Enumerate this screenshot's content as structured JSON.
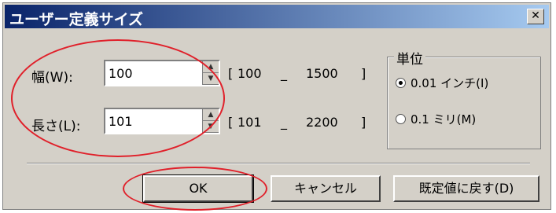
{
  "dialog": {
    "title": "ユーザー定義サイズ",
    "close_glyph": "✕"
  },
  "width_row": {
    "label": "幅(W):",
    "value": "100",
    "range_open": "[",
    "range_min": "100",
    "range_sep": "_",
    "range_max": "1500",
    "range_close": "]"
  },
  "length_row": {
    "label": "長さ(L):",
    "value": "101",
    "range_open": "[",
    "range_min": "101",
    "range_sep": "_",
    "range_max": "2200",
    "range_close": "]"
  },
  "units": {
    "title": "単位",
    "options": [
      {
        "label": "0.01 インチ(I)",
        "selected": true
      },
      {
        "label": "0.1 ミリ(M)",
        "selected": false
      }
    ]
  },
  "buttons": {
    "ok": "OK",
    "cancel": "キャンセル",
    "reset": "既定値に戻す(D)"
  },
  "colors": {
    "annotation": "#e0202a"
  }
}
